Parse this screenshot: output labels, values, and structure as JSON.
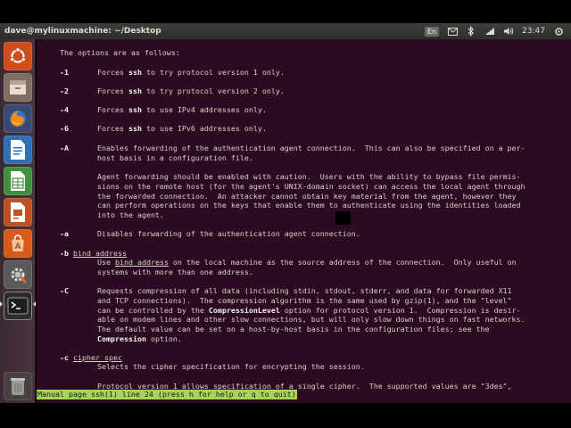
{
  "panel": {
    "window_title": "dave@mylinuxmachine: ~/Desktop",
    "keyboard_layout": "En",
    "clock": "23:47"
  },
  "launcher": {
    "items": [
      {
        "name": "ubuntu-dash-icon",
        "bg": "#d04e1c"
      },
      {
        "name": "files-icon",
        "bg": "#7f6f62"
      },
      {
        "name": "firefox-icon",
        "bg": "#3a4a70"
      },
      {
        "name": "libreoffice-writer-icon",
        "bg": "#2f6fb5"
      },
      {
        "name": "libreoffice-calc-icon",
        "bg": "#3f8f3c"
      },
      {
        "name": "libreoffice-impress-icon",
        "bg": "#c0501f"
      },
      {
        "name": "software-center-icon",
        "bg": "#d65a1c"
      },
      {
        "name": "system-settings-icon",
        "bg": "#5a5a5a"
      },
      {
        "name": "terminal-icon",
        "bg": "#2d2d2d"
      },
      {
        "name": "trash-icon",
        "bg": "#4a4040"
      }
    ]
  },
  "man": {
    "intro": "The options are as follows:",
    "opt1_flag": "-1",
    "opt1_pre": "Forces ",
    "opt1_cmd": "ssh",
    "opt1_post": " to try protocol version 1 only.",
    "opt2_flag": "-2",
    "opt2_pre": "Forces ",
    "opt2_cmd": "ssh",
    "opt2_post": " to try protocol version 2 only.",
    "opt4_flag": "-4",
    "opt4_pre": "Forces ",
    "opt4_cmd": "ssh",
    "opt4_post": " to use IPv4 addresses only.",
    "opt6_flag": "-6",
    "opt6_pre": "Forces ",
    "opt6_cmd": "ssh",
    "opt6_post": " to use IPv6 addresses only.",
    "optA_flag": "-A",
    "optA_l1": "Enables forwarding of the authentication agent connection.  This can also be specified on a per-",
    "optA_l2": "host basis in a configuration file.",
    "optA_l3": "Agent forwarding should be enabled with caution.  Users with the ability to bypass file permis-",
    "optA_l4": "sions on the remote host (for the agent's UNIX-domain socket) can access the local agent through",
    "optA_l5": "the forwarded connection.  An attacker cannot obtain key material from the agent, however they",
    "optA_l6": "can perform operations on the keys that enable them to authenticate using the identities loaded",
    "optA_l7": "into the agent.",
    "opta_flag": "-a",
    "opta_l1": "Disables forwarding of the authentication agent connection.",
    "optb_flag": "-b",
    "optb_arg": "bind_address",
    "optb_pre": "Use ",
    "optb_arg2": "bind_address",
    "optb_post": " on the local machine as the source address of the connection.  Only useful on",
    "optb_l2": "systems with more than one address.",
    "optC_flag": "-C",
    "optC_l1": "Requests compression of all data (including stdin, stdout, stderr, and data for forwarded X11",
    "optC_l2": "and TCP connections).  The compression algorithm is the same used by gzip(1), and the \"level\"",
    "optC_l3a": "can be controlled by the ",
    "optC_l3b": "CompressionLevel",
    "optC_l3c": " option for protocol version 1.  Compression is desir-",
    "optC_l4": "able on modem lines and other slow connections, but will only slow down things on fast networks.",
    "optC_l5": "The default value can be set on a host-by-host basis in the configuration files; see the",
    "optC_l6a": "Compression",
    "optC_l6b": " option.",
    "optc_flag": "-c",
    "optc_arg": "cipher_spec",
    "optc_l1": "Selects the cipher specification for encrypting the session.",
    "optc_l2": "Protocol version 1 allows specification of a single cipher.  The supported values are \"3des\",",
    "status": "Manual page ssh(1) line 24 (press h for help or q to quit)"
  },
  "colors": {
    "terminal_bg": "#2c0a21",
    "status_bg": "#a8d35a",
    "panel_bg": "#3c3b37"
  }
}
